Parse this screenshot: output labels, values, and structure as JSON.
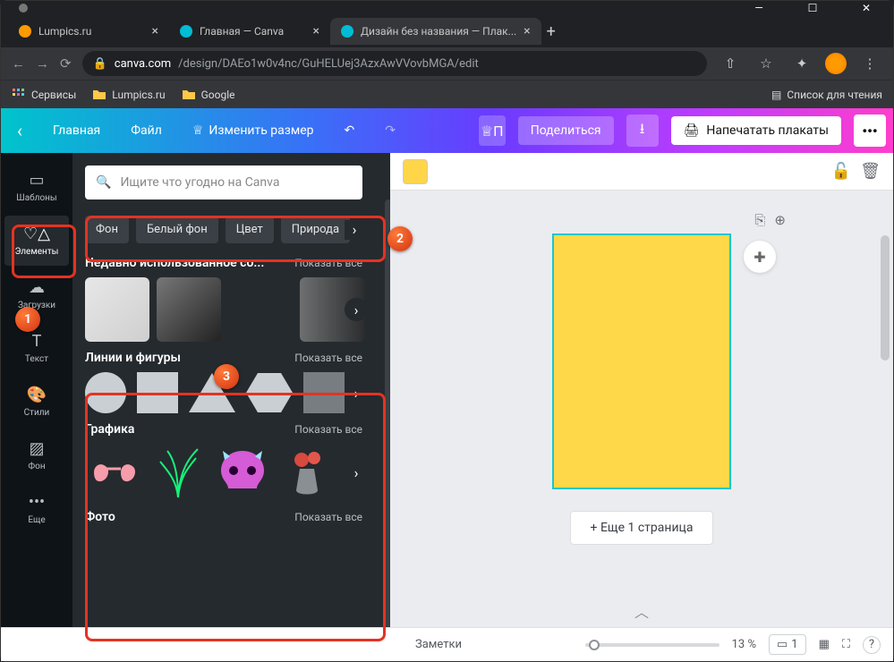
{
  "window": {
    "min": "—",
    "max": "☐",
    "close": "✕"
  },
  "tabs": [
    {
      "label": "Lumpics.ru",
      "favicon": "#ff9a00",
      "active": false
    },
    {
      "label": "Главная — Canva",
      "favicon": "#00bcd4",
      "active": false
    },
    {
      "label": "Дизайн без названия — Плак...",
      "favicon": "#00bcd4",
      "active": true
    }
  ],
  "newtab": "+",
  "address": {
    "lock": "🔒",
    "url_host": "canva.com",
    "url_path": "/design/DAEo1w0v4nc/GuHELUej3AzxAwVVovbMGA/edit"
  },
  "bookmarks": {
    "services": "Сервисы",
    "items": [
      "Lumpics.ru",
      "Google"
    ],
    "readlist": "Список для чтения"
  },
  "topbar": {
    "back": "‹",
    "home": "Главная",
    "file": "Файл",
    "resize": "Изменить размер",
    "undo": "↶",
    "redo": "↷",
    "premium": "П",
    "share": "Поделиться",
    "print": "Напечатать плакаты",
    "more": "•••"
  },
  "rail": {
    "templates": "Шаблоны",
    "elements": "Элементы",
    "uploads": "Загрузки",
    "text": "Текст",
    "styles": "Стили",
    "background": "Фон",
    "more": "Еще"
  },
  "panel": {
    "search_placeholder": "Ищите что угодно на Canva",
    "chips": [
      "Фон",
      "Белый фон",
      "Цвет",
      "Природа"
    ],
    "recent": {
      "title": "Недавно использованное со...",
      "seeall": "Показать все"
    },
    "shapes": {
      "title": "Линии и фигуры",
      "seeall": "Показать все"
    },
    "graphics": {
      "title": "Графика",
      "seeall": "Показать все"
    },
    "photo": {
      "title": "Фото",
      "seeall": "Показать все"
    }
  },
  "canvas": {
    "addpage": "+ Еще 1 страница"
  },
  "bottom": {
    "notes": "Заметки",
    "zoom": "13 %",
    "pages": "1"
  }
}
